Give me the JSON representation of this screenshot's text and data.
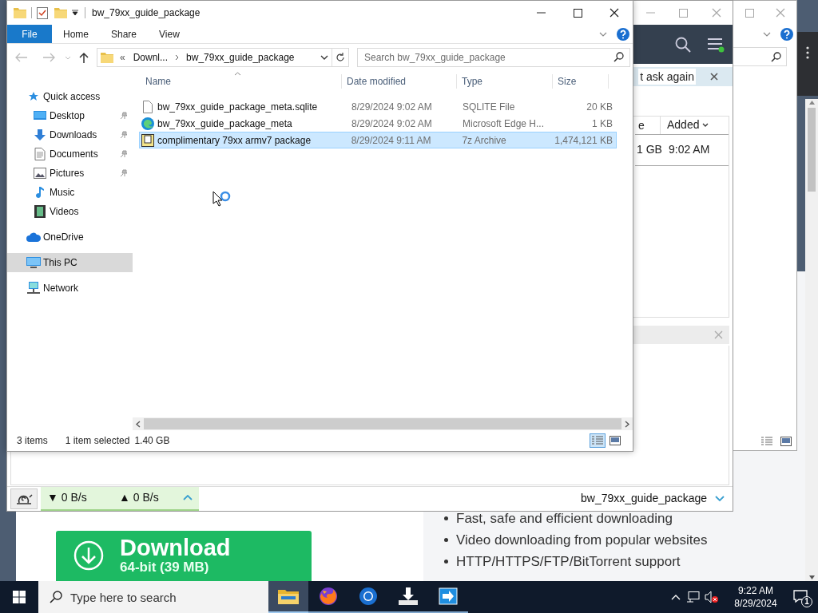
{
  "explorer": {
    "title": "bw_79xx_guide_package",
    "ribbon_tabs": [
      {
        "label": "File",
        "selected": true
      },
      {
        "label": "Home",
        "selected": false
      },
      {
        "label": "Share",
        "selected": false
      },
      {
        "label": "View",
        "selected": false
      }
    ],
    "address": {
      "overflow": "«",
      "crumbs": [
        "Downl...",
        "bw_79xx_guide_package"
      ]
    },
    "search": {
      "placeholder": "Search bw_79xx_guide_package"
    },
    "navigation": [
      {
        "label": "Quick access",
        "kind": "star",
        "selected": false,
        "children": [
          {
            "label": "Desktop",
            "kind": "desktop",
            "pinned": true,
            "selected": false
          },
          {
            "label": "Downloads",
            "kind": "download",
            "pinned": true,
            "selected": false
          },
          {
            "label": "Documents",
            "kind": "document",
            "pinned": true,
            "selected": false
          },
          {
            "label": "Pictures",
            "kind": "pictures",
            "pinned": true,
            "selected": false
          },
          {
            "label": "Music",
            "kind": "music",
            "pinned": false,
            "selected": false
          },
          {
            "label": "Videos",
            "kind": "video",
            "pinned": false,
            "selected": false
          }
        ]
      },
      {
        "label": "OneDrive",
        "kind": "cloud",
        "selected": false
      },
      {
        "label": "This PC",
        "kind": "pc",
        "selected": true
      },
      {
        "label": "Network",
        "kind": "network",
        "selected": false
      }
    ],
    "columns": [
      "Name",
      "Date modified",
      "Type",
      "Size"
    ],
    "files": [
      {
        "name": "bw_79xx_guide_package_meta.sqlite",
        "date": "8/29/2024 9:02 AM",
        "type": "SQLITE File",
        "size": "20 KB",
        "kind": "file",
        "selected": false
      },
      {
        "name": "bw_79xx_guide_package_meta",
        "date": "8/29/2024 9:02 AM",
        "type": "Microsoft Edge H...",
        "size": "1 KB",
        "kind": "edge",
        "selected": false
      },
      {
        "name": "complimentary 79xx armv7 package",
        "date": "8/29/2024 9:11 AM",
        "type": "7z Archive",
        "size": "1,474,121 KB",
        "kind": "archive",
        "selected": true
      }
    ],
    "status": {
      "items": "3 items",
      "selection": "1 item selected",
      "selection_size": "1.40 GB"
    },
    "views": [
      {
        "kind": "details",
        "selected": true
      },
      {
        "kind": "large",
        "selected": false
      }
    ]
  },
  "download_manager": {
    "notification": "t ask again",
    "columns": [
      "e",
      "Added"
    ],
    "row": [
      "1 GB",
      "9:02 AM"
    ],
    "download_speed": "▼ 0 B/s",
    "upload_speed": "▲ 0 B/s",
    "current_download": "bw_79xx_guide_package"
  },
  "web_page": {
    "download_button": {
      "label": "Download",
      "detail": "64-bit (39 MB)"
    },
    "features": [
      "Fast, safe and efficient downloading",
      "Video downloading from popular websites",
      "HTTP/HTTPS/FTP/BitTorrent support"
    ]
  },
  "taskbar": {
    "search_placeholder": "Type here to search",
    "apps": [
      {
        "kind": "folder",
        "selected": true
      },
      {
        "kind": "fox",
        "selected": false
      },
      {
        "kind": "ring",
        "selected": false
      },
      {
        "kind": "tray",
        "selected": false
      },
      {
        "kind": "remote",
        "selected": false
      }
    ],
    "time": "9:22 AM",
    "date": "8/29/2024",
    "notifications": "1"
  }
}
